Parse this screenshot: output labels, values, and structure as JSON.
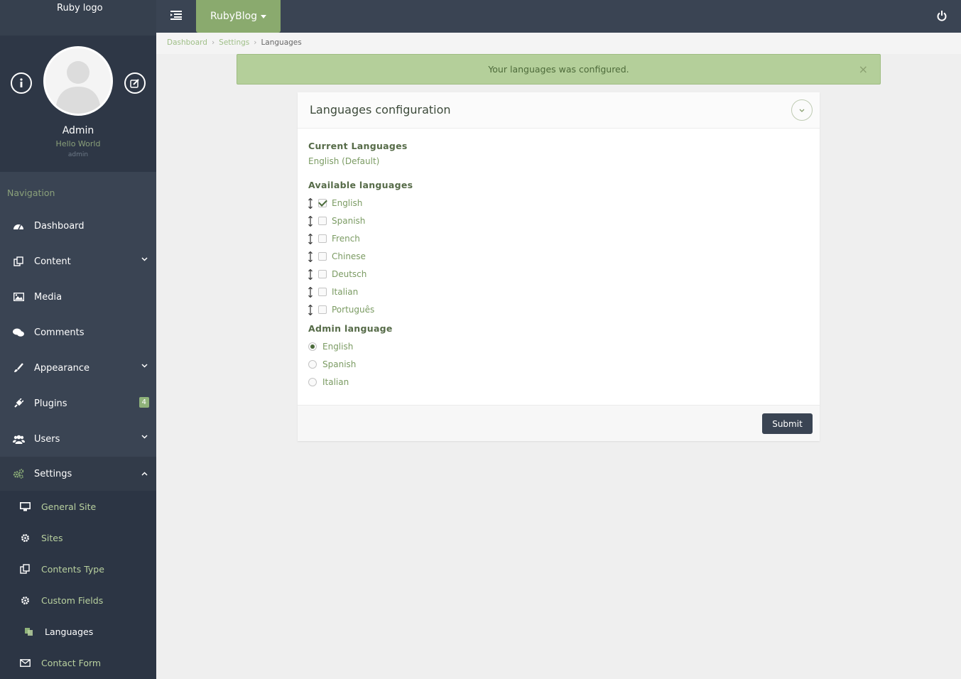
{
  "sidebar": {
    "logo_text": "Ruby logo",
    "profile": {
      "name": "Admin",
      "greeting": "Hello World",
      "role": "admin"
    },
    "nav_heading": "Navigation",
    "items": [
      {
        "label": "Dashboard",
        "icon": "dashboard-icon"
      },
      {
        "label": "Content",
        "icon": "content-icon",
        "has_chevron": true
      },
      {
        "label": "Media",
        "icon": "media-icon"
      },
      {
        "label": "Comments",
        "icon": "comments-icon"
      },
      {
        "label": "Appearance",
        "icon": "brush-icon",
        "has_chevron": true
      },
      {
        "label": "Plugins",
        "icon": "plug-icon",
        "badge": "4"
      },
      {
        "label": "Users",
        "icon": "users-icon",
        "has_chevron": true
      },
      {
        "label": "Settings",
        "icon": "cogs-icon",
        "has_chevron": true,
        "expanded": true
      }
    ],
    "settings_sub": [
      {
        "label": "General Site",
        "icon": "desktop-icon"
      },
      {
        "label": "Sites",
        "icon": "cog-icon"
      },
      {
        "label": "Contents Type",
        "icon": "copy-icon"
      },
      {
        "label": "Custom Fields",
        "icon": "cog-icon"
      },
      {
        "label": "Languages",
        "icon": "language-icon",
        "current": true
      },
      {
        "label": "Contact Form",
        "icon": "envelope-icon"
      }
    ]
  },
  "topbar": {
    "brand": "RubyBlog"
  },
  "breadcrumb": {
    "items": [
      "Dashboard",
      "Settings",
      "Languages"
    ]
  },
  "alert": {
    "message": "Your languages was configured.",
    "close": "×"
  },
  "panel": {
    "title": "Languages configuration",
    "current_label": "Current Languages",
    "current_value": "English (Default)",
    "available_label": "Available languages",
    "available": [
      {
        "label": "English",
        "checked": true
      },
      {
        "label": "Spanish",
        "checked": false
      },
      {
        "label": "French",
        "checked": false
      },
      {
        "label": "Chinese",
        "checked": false
      },
      {
        "label": "Deutsch",
        "checked": false
      },
      {
        "label": "Italian",
        "checked": false
      },
      {
        "label": "Português",
        "checked": false
      }
    ],
    "admin_label": "Admin language",
    "admin_options": [
      {
        "label": "English",
        "selected": true
      },
      {
        "label": "Spanish",
        "selected": false
      },
      {
        "label": "Italian",
        "selected": false
      }
    ],
    "submit": "Submit"
  },
  "colors": {
    "sidebar_bg": "#3a4453",
    "accent_green": "#8aaa6e",
    "alert_bg": "#b4cf9a"
  }
}
